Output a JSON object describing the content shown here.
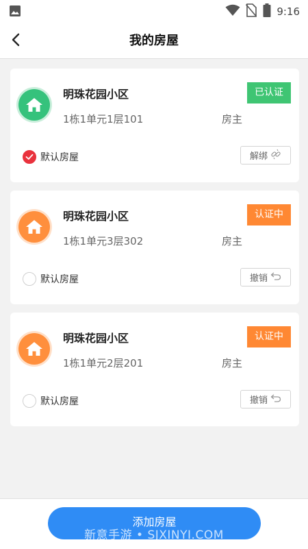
{
  "status_bar": {
    "time": "9:16",
    "icons": [
      "image-icon",
      "wifi-icon",
      "no-sim-icon",
      "battery-icon"
    ]
  },
  "header": {
    "back_icon": "chevron-left-icon",
    "title": "我的房屋"
  },
  "houses": [
    {
      "community": "明珠花园小区",
      "unit": "1栋1单元1层101",
      "role": "房主",
      "status": "已认证",
      "status_color": "#3fc573",
      "icon_color": "#35c27c",
      "is_default": true,
      "default_label": "默认房屋",
      "action_label": "解绑",
      "action_icon": "unlink-icon"
    },
    {
      "community": "明珠花园小区",
      "unit": "1栋1单元3层302",
      "role": "房主",
      "status": "认证中",
      "status_color": "#ff8833",
      "icon_color": "#ff8f3d",
      "is_default": false,
      "default_label": "默认房屋",
      "action_label": "撤销",
      "action_icon": "undo-icon"
    },
    {
      "community": "明珠花园小区",
      "unit": "1栋1单元2层201",
      "role": "房主",
      "status": "认证中",
      "status_color": "#ff8833",
      "icon_color": "#ff8f3d",
      "is_default": false,
      "default_label": "默认房屋",
      "action_label": "撤销",
      "action_icon": "undo-icon"
    }
  ],
  "footer": {
    "add_button": "添加房屋"
  },
  "watermark": "新意手游 • SJXINYI.COM"
}
